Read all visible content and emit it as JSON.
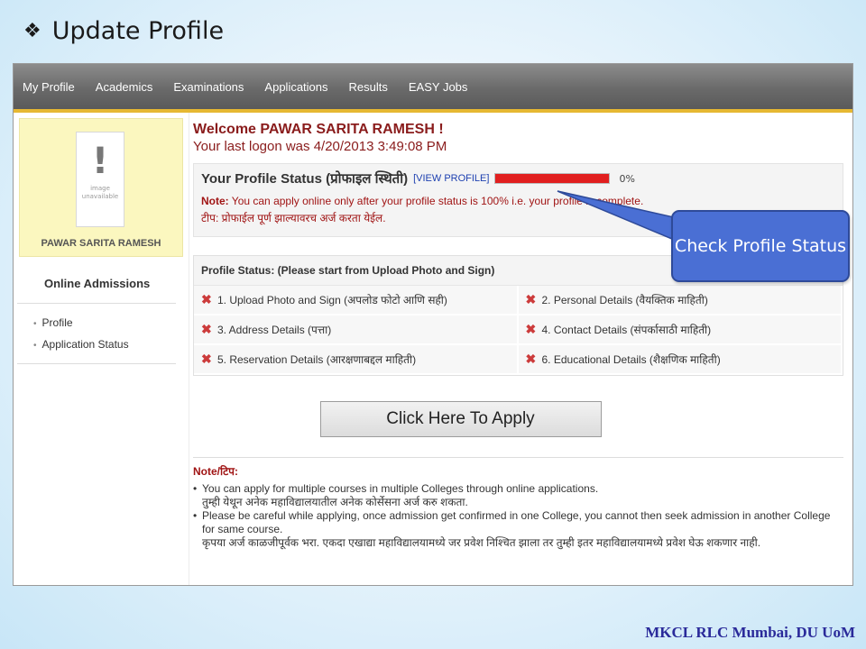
{
  "slide": {
    "title": "Update Profile",
    "bullet_icon": "four-diamond-bullet",
    "footer": "MKCL RLC Mumbai, DU UoM"
  },
  "nav": {
    "items": [
      "My Profile",
      "Academics",
      "Examinations",
      "Applications",
      "Results",
      "EASY Jobs"
    ]
  },
  "sidebar": {
    "photo_text": "image unavailable",
    "student_name": "PAWAR SARITA RAMESH",
    "section_title": "Online Admissions",
    "menu": [
      "Profile",
      "Application Status"
    ]
  },
  "main": {
    "welcome": "Welcome PAWAR SARITA RAMESH !",
    "last_logon": "Your last logon was 4/20/2013 3:49:08 PM",
    "profile_status_label": "Your Profile Status (प्रोफाइल स्थिती)",
    "view_profile_link": "[VIEW PROFILE]",
    "progress_percent": 0,
    "progress_text": "0%",
    "note_label": "Note:",
    "note_text": "You can apply online only after your profile status is 100% i.e. your profile is complete.",
    "tip_text": "टीप: प्रोफाईल पूर्ण झाल्यावरच अर्ज करता येईल.",
    "ps_title": "Profile Status: (Please start from Upload Photo and Sign)",
    "steps": [
      "1. Upload Photo and Sign (अपलोड फोटो आणि सही)",
      "2. Personal Details (वैयक्तिक माहिती)",
      "3. Address Details (पत्ता)",
      "4. Contact Details (संपर्कासाठी माहिती)",
      "5. Reservation Details (आरक्षणाबद्दल माहिती)",
      "6. Educational Details (शैक्षणिक माहिती)"
    ],
    "apply_button": "Click Here To Apply",
    "notes_heading": "Note/टिप:",
    "note1_en": "You can apply for multiple courses in multiple Colleges through online applications.",
    "note1_mr": "तुम्ही येथून अनेक महाविद्यालयातील अनेक कोर्सेसना अर्ज करु शकता.",
    "note2_en_a": "Please be careful while applying, once admission get confirmed in one College, you cannot then seek admission in another College",
    "note2_en_b": "for same course.",
    "note2_mr": "कृपया अर्ज काळजीपूर्वक भरा. एकदा एखाद्या महाविद्यालयामध्ये जर प्रवेश निश्चित झाला तर तुम्ही इतर महाविद्यालयामध्ये प्रवेश घेऊ शकणार नाही."
  },
  "callout": {
    "text": "Check Profile Status",
    "color": "#4a6fd4"
  }
}
